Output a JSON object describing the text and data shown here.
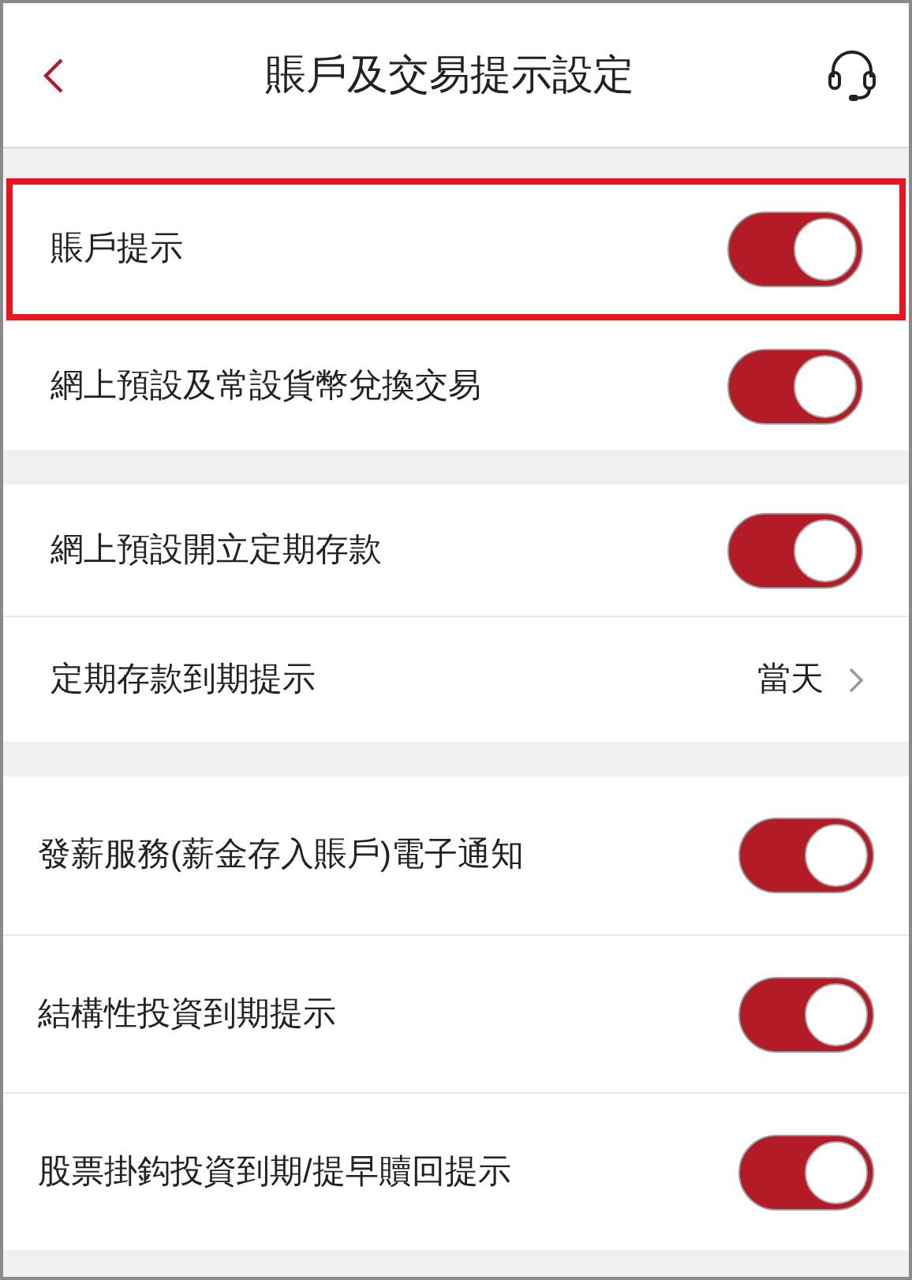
{
  "header": {
    "title": "賬戶及交易提示設定"
  },
  "sections": [
    {
      "items": [
        {
          "kind": "toggle",
          "label": "賬戶提示",
          "on": true,
          "highlighted": true
        },
        {
          "kind": "toggle",
          "label": "網上預設及常設貨幣兌換交易",
          "on": true,
          "highlighted": false
        }
      ]
    },
    {
      "items": [
        {
          "kind": "toggle",
          "label": "網上預設開立定期存款",
          "on": true,
          "highlighted": false
        },
        {
          "kind": "link",
          "label": "定期存款到期提示",
          "value": "當天",
          "highlighted": false
        }
      ]
    },
    {
      "items": [
        {
          "kind": "toggle",
          "label": "發薪服務(薪金存入賬戶)電子通知",
          "on": true,
          "highlighted": false
        },
        {
          "kind": "toggle",
          "label": "結構性投資到期提示",
          "on": true,
          "highlighted": false
        },
        {
          "kind": "toggle",
          "label": "股票掛鈎投資到期/提早贖回提示",
          "on": true,
          "highlighted": false
        }
      ]
    }
  ]
}
